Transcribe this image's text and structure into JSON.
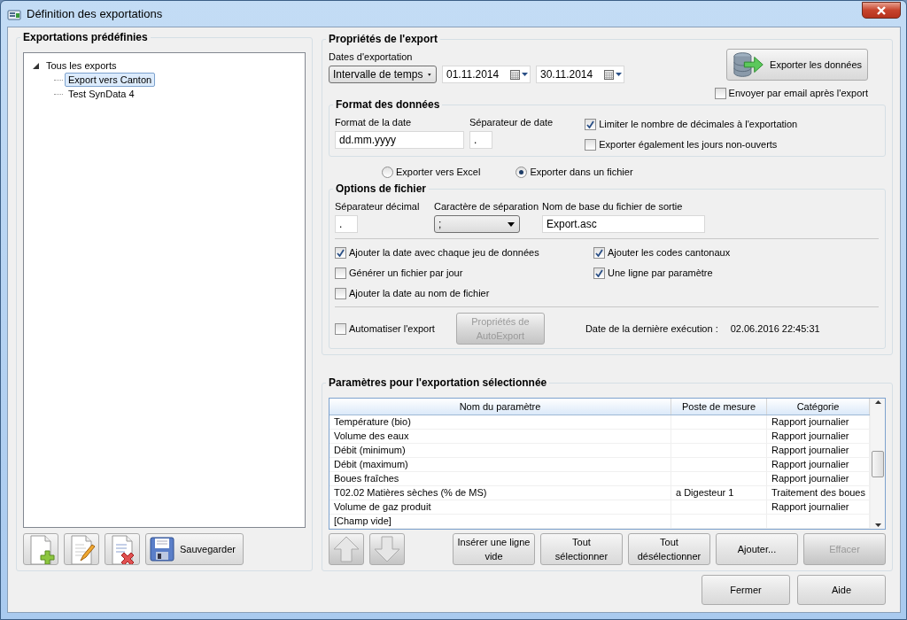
{
  "window": {
    "title": "Définition des exportations"
  },
  "predefined": {
    "heading": "Exportations prédéfinies",
    "tree": [
      {
        "label": "Tous les exports",
        "expanded": true,
        "selected": false,
        "children": [
          {
            "label": "Export vers Canton",
            "selected": true
          },
          {
            "label": "Test SynData 4",
            "selected": false
          }
        ]
      }
    ],
    "toolbar": [
      {
        "kind": "new"
      },
      {
        "kind": "edit"
      },
      {
        "kind": "delete"
      },
      {
        "kind": "save",
        "label": "Sauvegarder"
      }
    ]
  },
  "export_properties": {
    "heading": "Propriétés de l'export",
    "dates_label": "Dates d'exportation",
    "range_select": "Intervalle de temps",
    "date_from": "01.11.2014",
    "date_to": "30.11.2014",
    "export_button": "Exporter les données",
    "email": {
      "label": "Envoyer par email après l'export",
      "checked": false
    },
    "data_format": {
      "heading": "Format des données",
      "date_format": {
        "label": "Format de la date",
        "value": "dd.mm.yyyy"
      },
      "date_separator": {
        "label": "Séparateur de date",
        "value": "."
      },
      "checkboxes": [
        {
          "label": "Limiter le nombre de décimales à l'exportation",
          "checked": true
        },
        {
          "label": "Exporter également les jours non-ouverts",
          "checked": false
        }
      ]
    },
    "targets": [
      {
        "label": "Exporter vers Excel",
        "selected": false
      },
      {
        "label": "Exporter dans un fichier",
        "selected": true
      }
    ],
    "file_options": {
      "heading": "Options de fichier",
      "decimal_separator": {
        "label": "Séparateur décimal",
        "value": "."
      },
      "separator_char": {
        "label": "Caractère de séparation",
        "value": ";"
      },
      "base_name": {
        "label": "Nom de base du fichier de sortie",
        "value": "Export.asc"
      },
      "checkboxes": [
        {
          "label": "Ajouter la date avec chaque jeu de données",
          "checked": true
        },
        {
          "label": "Ajouter les codes cantonaux",
          "checked": true
        },
        {
          "label": "Générer un fichier par jour",
          "checked": false
        },
        {
          "label": "Une ligne par paramètre",
          "checked": true
        },
        {
          "label": "Ajouter la date au nom de fichier",
          "checked": false
        }
      ],
      "automate": {
        "label": "Automatiser l'export",
        "checked": false
      },
      "autoexport_button": {
        "label": "Propriétés de AutoExport",
        "disabled": true
      },
      "last_run_label": "Date de la dernière exécution :",
      "last_run_value": "02.06.2016 22:45:31"
    }
  },
  "parameters": {
    "heading": "Paramètres pour l'exportation sélectionnée",
    "columns": [
      "Nom du paramètre",
      "Poste de mesure",
      "Catégorie"
    ],
    "rows": [
      [
        "Température (bio)",
        "",
        "Rapport journalier"
      ],
      [
        "Volume des eaux",
        "",
        "Rapport journalier"
      ],
      [
        "Débit (minimum)",
        "",
        "Rapport journalier"
      ],
      [
        "Débit (maximum)",
        "",
        "Rapport journalier"
      ],
      [
        "Boues fraîches",
        "",
        "Rapport journalier"
      ],
      [
        "T02.02 Matières sèches (% de MS)",
        "a Digesteur 1",
        "Traitement des boues"
      ],
      [
        "Volume de gaz produit",
        "",
        "Rapport journalier"
      ],
      [
        "[Champ vide]",
        "",
        ""
      ]
    ],
    "move_buttons": [
      {
        "kind": "up",
        "disabled": true
      },
      {
        "kind": "down",
        "disabled": true
      }
    ],
    "buttons": [
      {
        "label": "Insérer une ligne vide",
        "disabled": false
      },
      {
        "label": "Tout sélectionner",
        "disabled": false
      },
      {
        "label": "Tout désélectionner",
        "disabled": false
      },
      {
        "label": "Ajouter...",
        "disabled": false
      },
      {
        "label": "Effacer",
        "disabled": true
      }
    ]
  },
  "footer_buttons": [
    "Fermer",
    "Aide"
  ]
}
